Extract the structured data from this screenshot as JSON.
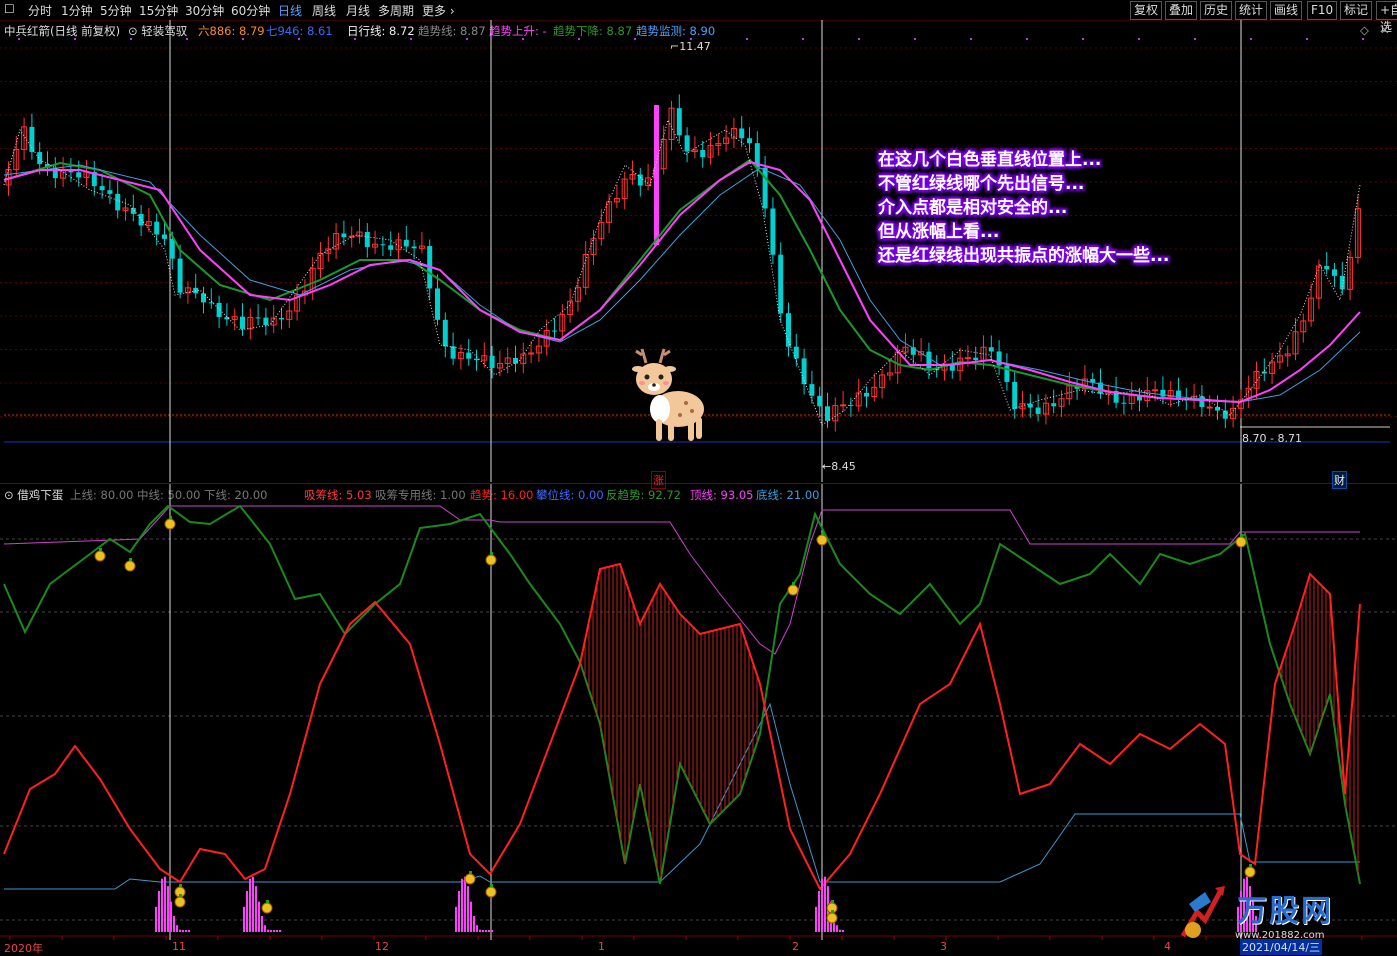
{
  "toolbar": {
    "periods": [
      "分时",
      "1分钟",
      "5分钟",
      "15分钟",
      "30分钟",
      "60分钟",
      "日线",
      "周线",
      "月线",
      "多周期",
      "更多"
    ],
    "active": "日线",
    "right_buttons": [
      "复权",
      "叠加",
      "历史",
      "统计",
      "画线",
      "F10",
      "标记",
      "+自选"
    ]
  },
  "main_header": {
    "stock": "中兵红箭(日线 前复权)",
    "indicator": "轻装驾驭",
    "six": "六886: 8.79",
    "seven": "七946: 8.61",
    "day_line": "日行线: 8.72",
    "trend_line": "趋势线: 8.87",
    "trend_up": "趋势上升: -",
    "trend_down": "趋势下降: 8.87",
    "trend_monitor": "趋势监测: 8.90"
  },
  "main_chart": {
    "high_label": "11.47",
    "low_label": "8.45",
    "right_label": "8.70 - 8.71",
    "zhang": "涨",
    "cai": "财"
  },
  "annotation": [
    "在这几个白色垂直线位置上...",
    "不管红绿线哪个先出信号...",
    "介入点都是相对安全的...",
    "但从涨幅上看...",
    "还是红绿线出现共振点的涨幅大一些..."
  ],
  "indicator_header": {
    "name": "借鸡下蛋",
    "upper": "上线: 80.00",
    "middle": "中线: 50.00",
    "lower": "下线: 20.00",
    "xichou": "吸筹线: 5.03",
    "xichou_special": "吸筹专用线: 1.00",
    "trend": "趋势: 16.00",
    "position": "攀位线: 0.00",
    "reverse": "反趋势: 92.72",
    "top": "顶线: 93.05",
    "bottom": "底线: 21.00"
  },
  "x_axis": {
    "labels": [
      "2020年",
      "11",
      "12",
      "1",
      "2",
      "3",
      "4"
    ],
    "date_box": "2021/04/14/三"
  },
  "watermark": {
    "name": "万股网",
    "url": "www.201882.com"
  },
  "colors": {
    "up": "#ff3232",
    "down": "#00d0d0",
    "ma_green": "#1a9a2a",
    "ma_magenta": "#ff40ff",
    "ma_blue": "#3aa0e0",
    "trend_red": "#ff2020",
    "trend_green": "#1a8a1a"
  }
}
